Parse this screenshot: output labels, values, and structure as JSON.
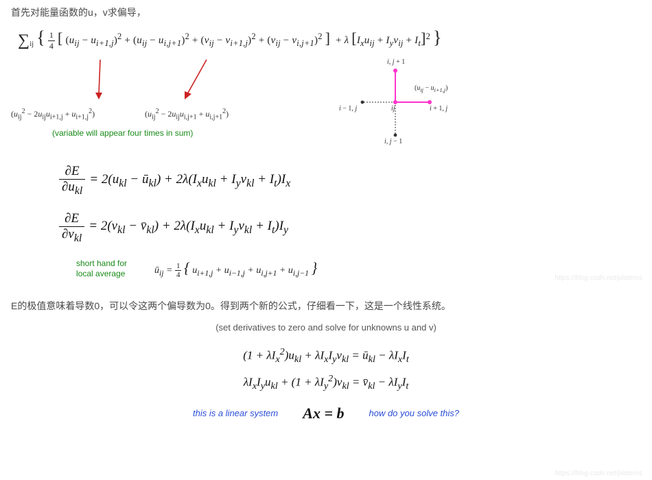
{
  "text": {
    "para1": "首先对能量函数的u，v求偏导，",
    "para2": "E的极值意味着导数0，可以令这两个偏导数为0。得到两个新的公式，仔细看一下，这是一个线性系统。",
    "set_zero_note": "(set derivatives to zero and solve for unknowns u and v)"
  },
  "energy_sum": {
    "tex": "∑_{ij} { ¼ [ (u_{ij} − u_{i+1,j})² + (u_{ij} − u_{i,j+1})² + (v_{ij} − v_{i+1,j})² + (v_{ij} − v_{i,j+1})² ] + λ [ I_x u_{ij} + I_y v_{ij} + I_t ]² }"
  },
  "expansions": {
    "left": "(u_{ij}² − 2u_{ij}u_{i+1,j} + u_{i+1,j}²)",
    "right": "(u_{ij}² − 2u_{ij}u_{i,j+1} + u_{i,j+1}²)",
    "note": "(variable will appear four times in sum)"
  },
  "stencil_labels": {
    "top": "i, j + 1",
    "right_edge": "(u_{ij} − u_{i+1,j})",
    "left": "i − 1, j",
    "center": "ij",
    "right": "i + 1, j",
    "bottom": "i, j − 1"
  },
  "partials": {
    "dE_du_label_num": "∂E",
    "dE_du_label_den": "∂u_{kl}",
    "dE_du_rhs": "= 2(u_{kl} − ū_{kl}) + 2λ(I_x u_{kl} + I_y v_{kl} + I_t) I_x",
    "dE_dv_label_num": "∂E",
    "dE_dv_label_den": "∂v_{kl}",
    "dE_dv_rhs": "= 2(v_{kl} − v̄_{kl}) + 2λ(I_x u_{kl} + I_y v_{kl} + I_t) I_y"
  },
  "shorthand": {
    "label_line1": "short hand for",
    "label_line2": "local average",
    "equation": "ū_{ij} = ¼ { u_{i+1,j} + u_{i−1,j} + u_{i,j+1} + u_{i,j−1} }"
  },
  "linear_system": {
    "eq1": "(1 + λI_x²) u_{kl} + λ I_x I_y v_{kl} = ū_{kl} − λ I_x I_t",
    "eq2": "λ I_x I_y u_{kl} + (1 + λI_y²) v_{kl} = v̄_{kl} − λ I_y I_t",
    "left_note": "this is a linear system",
    "matrix_form": "A x = b",
    "right_note": "how do you solve this?"
  },
  "watermark": "https://blog.csdn.net/plateros",
  "chart_data": {
    "type": "diagram",
    "title": "5-point stencil of grid neighbours around (i,j)",
    "nodes": [
      {
        "id": "center",
        "x": 0,
        "y": 0,
        "label": "ij"
      },
      {
        "id": "top",
        "x": 0,
        "y": 1,
        "label": "i, j+1"
      },
      {
        "id": "bottom",
        "x": 0,
        "y": -1,
        "label": "i, j-1"
      },
      {
        "id": "left",
        "x": -1,
        "y": 0,
        "label": "i-1, j"
      },
      {
        "id": "right",
        "x": 1,
        "y": 0,
        "label": "i+1, j"
      }
    ],
    "edges": [
      {
        "from": "center",
        "to": "top",
        "highlight": true,
        "color": "#ff33cc"
      },
      {
        "from": "center",
        "to": "right",
        "highlight": true,
        "color": "#ff33cc",
        "edge_label": "(u_{ij} − u_{i+1,j})"
      },
      {
        "from": "center",
        "to": "left",
        "highlight": false,
        "style": "dotted"
      },
      {
        "from": "center",
        "to": "bottom",
        "highlight": false,
        "style": "dotted"
      }
    ]
  }
}
